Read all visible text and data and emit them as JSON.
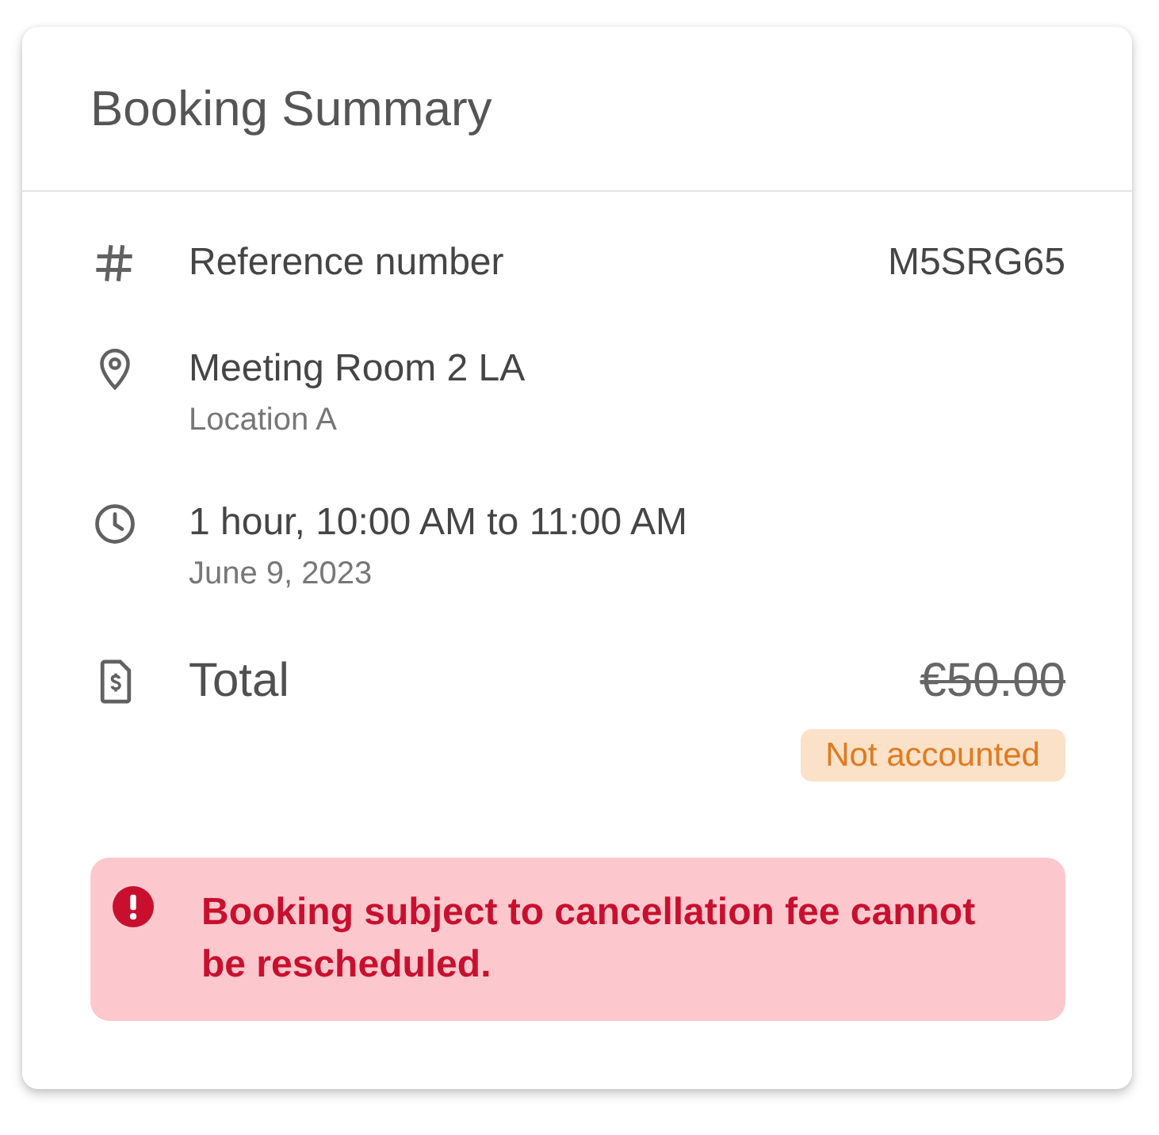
{
  "card": {
    "title": "Booking Summary"
  },
  "details": [
    {
      "kind": "reference",
      "label": "Reference number",
      "value": "M5SRG65"
    },
    {
      "kind": "location",
      "label": "Meeting Room 2 LA",
      "sublabel": "Location A"
    },
    {
      "kind": "time",
      "label": "1 hour, 10:00 AM to 11:00 AM",
      "sublabel": "June 9, 2023"
    }
  ],
  "total": {
    "label": "Total",
    "amount": "€50.00",
    "struck": true,
    "badge": "Not accounted"
  },
  "alert": {
    "kind": "error",
    "message": "Booking subject to cancellation fee cannot be rescheduled."
  }
}
